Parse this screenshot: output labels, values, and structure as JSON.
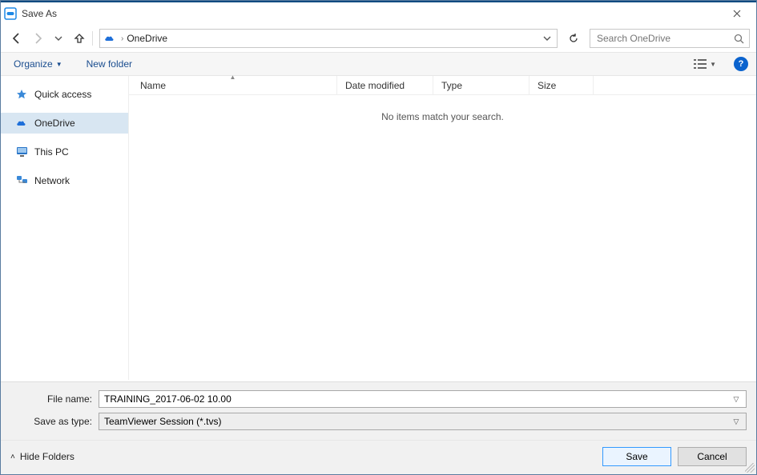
{
  "window": {
    "title": "Save As"
  },
  "nav": {
    "address": {
      "location": "OneDrive",
      "separator": "›"
    },
    "search": {
      "placeholder": "Search OneDrive"
    }
  },
  "toolbar": {
    "organize": "Organize",
    "new_folder": "New folder"
  },
  "navpane": {
    "quick_access": "Quick access",
    "onedrive": "OneDrive",
    "this_pc": "This PC",
    "network": "Network"
  },
  "columns": {
    "name": "Name",
    "date": "Date modified",
    "type": "Type",
    "size": "Size"
  },
  "list": {
    "empty": "No items match your search."
  },
  "form": {
    "file_name_label": "File name:",
    "file_name_value": "TRAINING_2017-06-02 10.00",
    "save_type_label": "Save as type:",
    "save_type_value": "TeamViewer Session (*.tvs)"
  },
  "actions": {
    "hide_folders": "Hide Folders",
    "save": "Save",
    "cancel": "Cancel"
  }
}
